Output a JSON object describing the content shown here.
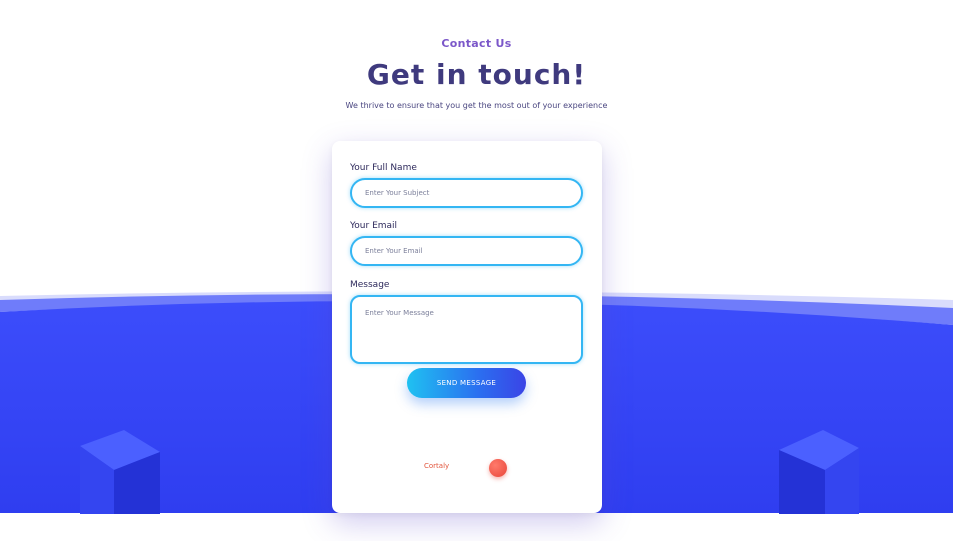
{
  "header": {
    "eyebrow": "Contact Us",
    "title": "Get in touch!",
    "subtitle": "We thrive to ensure that you get the most out of your experience"
  },
  "form": {
    "name_label": "Your Full Name",
    "name_placeholder": "Enter Your Subject",
    "name_value": "",
    "email_label": "Your Email",
    "email_placeholder": "Enter Your Email",
    "email_value": "",
    "message_label": "Message",
    "message_placeholder": "Enter Your Message",
    "message_value": "",
    "send_label": "SEND MESSAGE"
  },
  "footer": {
    "brand": "Cortaly"
  },
  "colors": {
    "accent_blue": "#3a44f5",
    "title": "#3f3a7e",
    "eyebrow": "#7b57c9",
    "field_border": "#34b6f3",
    "brand_red": "#e2553c"
  },
  "icons": {
    "brand_dot": "red-circle-icon",
    "cube_left": "cube-icon",
    "cube_right": "cube-icon"
  }
}
